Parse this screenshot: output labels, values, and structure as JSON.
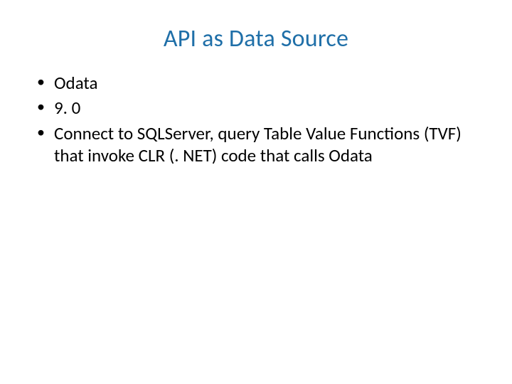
{
  "slide": {
    "title": "API as Data Source",
    "bullets": [
      "Odata",
      "9. 0",
      "Connect to SQLServer, query Table Value Functions (TVF) that invoke CLR (. NET) code that calls Odata"
    ]
  }
}
